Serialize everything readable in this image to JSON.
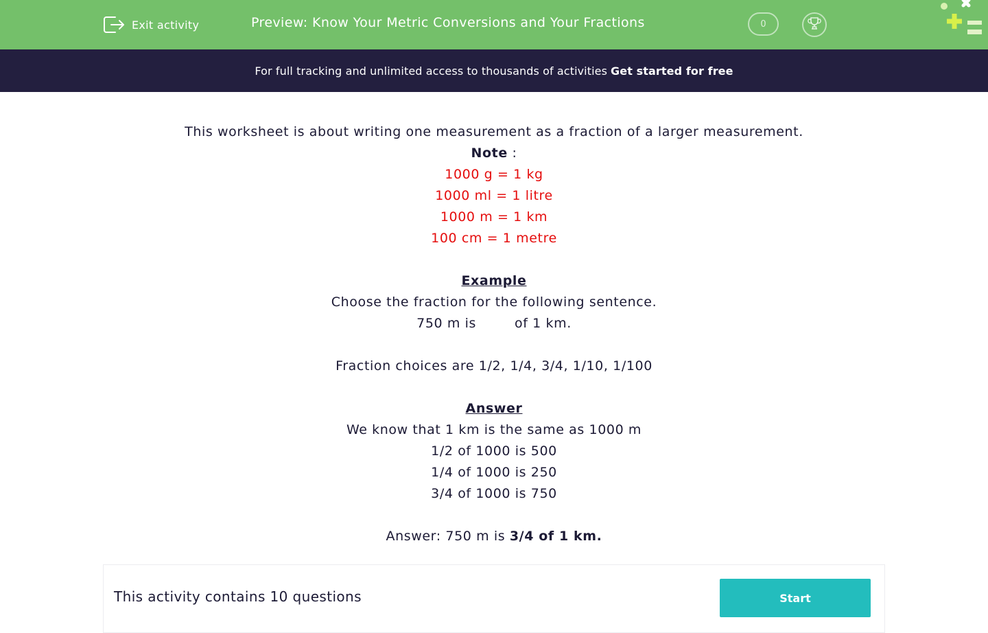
{
  "colors": {
    "header_bg": "#74c06a",
    "banner_bg": "#231f3f",
    "accent_red": "#e50d0d",
    "start_button": "#23bdbd",
    "text_dark": "#1c1a35"
  },
  "header": {
    "exit_icon": "exit-icon",
    "exit_label": "Exit activity",
    "title": "Preview: Know Your Metric Conversions and Your Fractions",
    "score": "0",
    "trophy_icon": "trophy-icon"
  },
  "banner": {
    "text": "For full tracking and unlimited access to thousands of activities",
    "cta": "Get started for free"
  },
  "content": {
    "intro": "This worksheet is about writing one measurement as a fraction of a larger measurement.",
    "note_label": "Note",
    "note_colon": " :",
    "conversions": [
      "1000 g = 1 kg",
      "1000 ml = 1 litre",
      "1000 m = 1 km",
      "100 cm = 1 metre"
    ],
    "example_heading": "Example",
    "example_instruction": "Choose the fraction for the following sentence.",
    "example_sentence_start": "750 m is",
    "example_sentence_end": "of 1 km.",
    "fraction_choices": "Fraction choices are 1/2, 1/4, 3/4, 1/10, 1/100",
    "answer_heading": "Answer",
    "answer_lines": [
      "We know that 1 km is the same as 1000 m",
      "1/2 of 1000 is 500",
      "1/4 of 1000 is 250",
      "3/4 of 1000 is 750"
    ],
    "final_answer_prefix": "Answer: 750 m is ",
    "final_answer_bold": "3/4 of 1 km."
  },
  "footer": {
    "question_count_text": "This activity contains 10 questions",
    "start_label": "Start"
  }
}
